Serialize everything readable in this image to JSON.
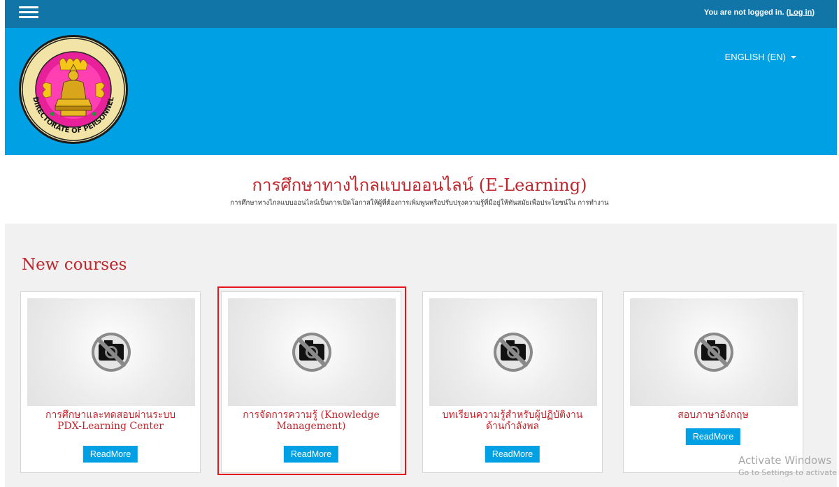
{
  "topbar": {
    "menu_icon": "hamburger-menu-icon",
    "login_text": "You are not logged in. (",
    "login_link": "Log in",
    "login_suffix": ")"
  },
  "header": {
    "logo_icon": "directorate-of-personnel-seal",
    "logo_text_bottom": "DIRECTORATE OF PERSONNEL",
    "language": "ENGLISH (EN)"
  },
  "site": {
    "title": "การศึกษาทางไกลแบบออนไลน์ (E-Learning)",
    "subtitle": "การศึกษาทางไกลแบบออนไลน์เป็นการเปิดโอกาสให้ผู้ที่ต้องการเพิ่มพูนหรือปรับปรุงความรู้ที่มีอยู่ให้ทันสมัยเพื่อประโยชน์ใน การทำงาน"
  },
  "new_courses": {
    "heading": "New courses",
    "courses": [
      {
        "title_line1": "การศึกษาและทดสอบผ่านระบบ",
        "title_line2": "PDX-Learning Center",
        "button": "ReadMore",
        "image_icon": "no-image-camera-icon"
      },
      {
        "title_line1": "การจัดการความรู้ (Knowledge",
        "title_line2": "Management)",
        "button": "ReadMore",
        "image_icon": "no-image-camera-icon"
      },
      {
        "title_line1": "บทเรียนความรู้สำหรับผู้ปฏิบัติงาน",
        "title_line2": "ด้านกำลังพล",
        "button": "ReadMore",
        "image_icon": "no-image-camera-icon"
      },
      {
        "title_line1": "สอบภาษาอังกฤษ",
        "title_line2": "",
        "button": "ReadMore",
        "image_icon": "no-image-camera-icon"
      }
    ]
  },
  "watermark": {
    "line1": "Activate Windows",
    "line2": "Go to Settings to activate Windows."
  },
  "colors": {
    "topbar": "#1175a8",
    "header": "#00a1e4",
    "title_red": "#c0252b",
    "highlight_red": "#e4161b",
    "button_blue": "#00a1e4"
  }
}
